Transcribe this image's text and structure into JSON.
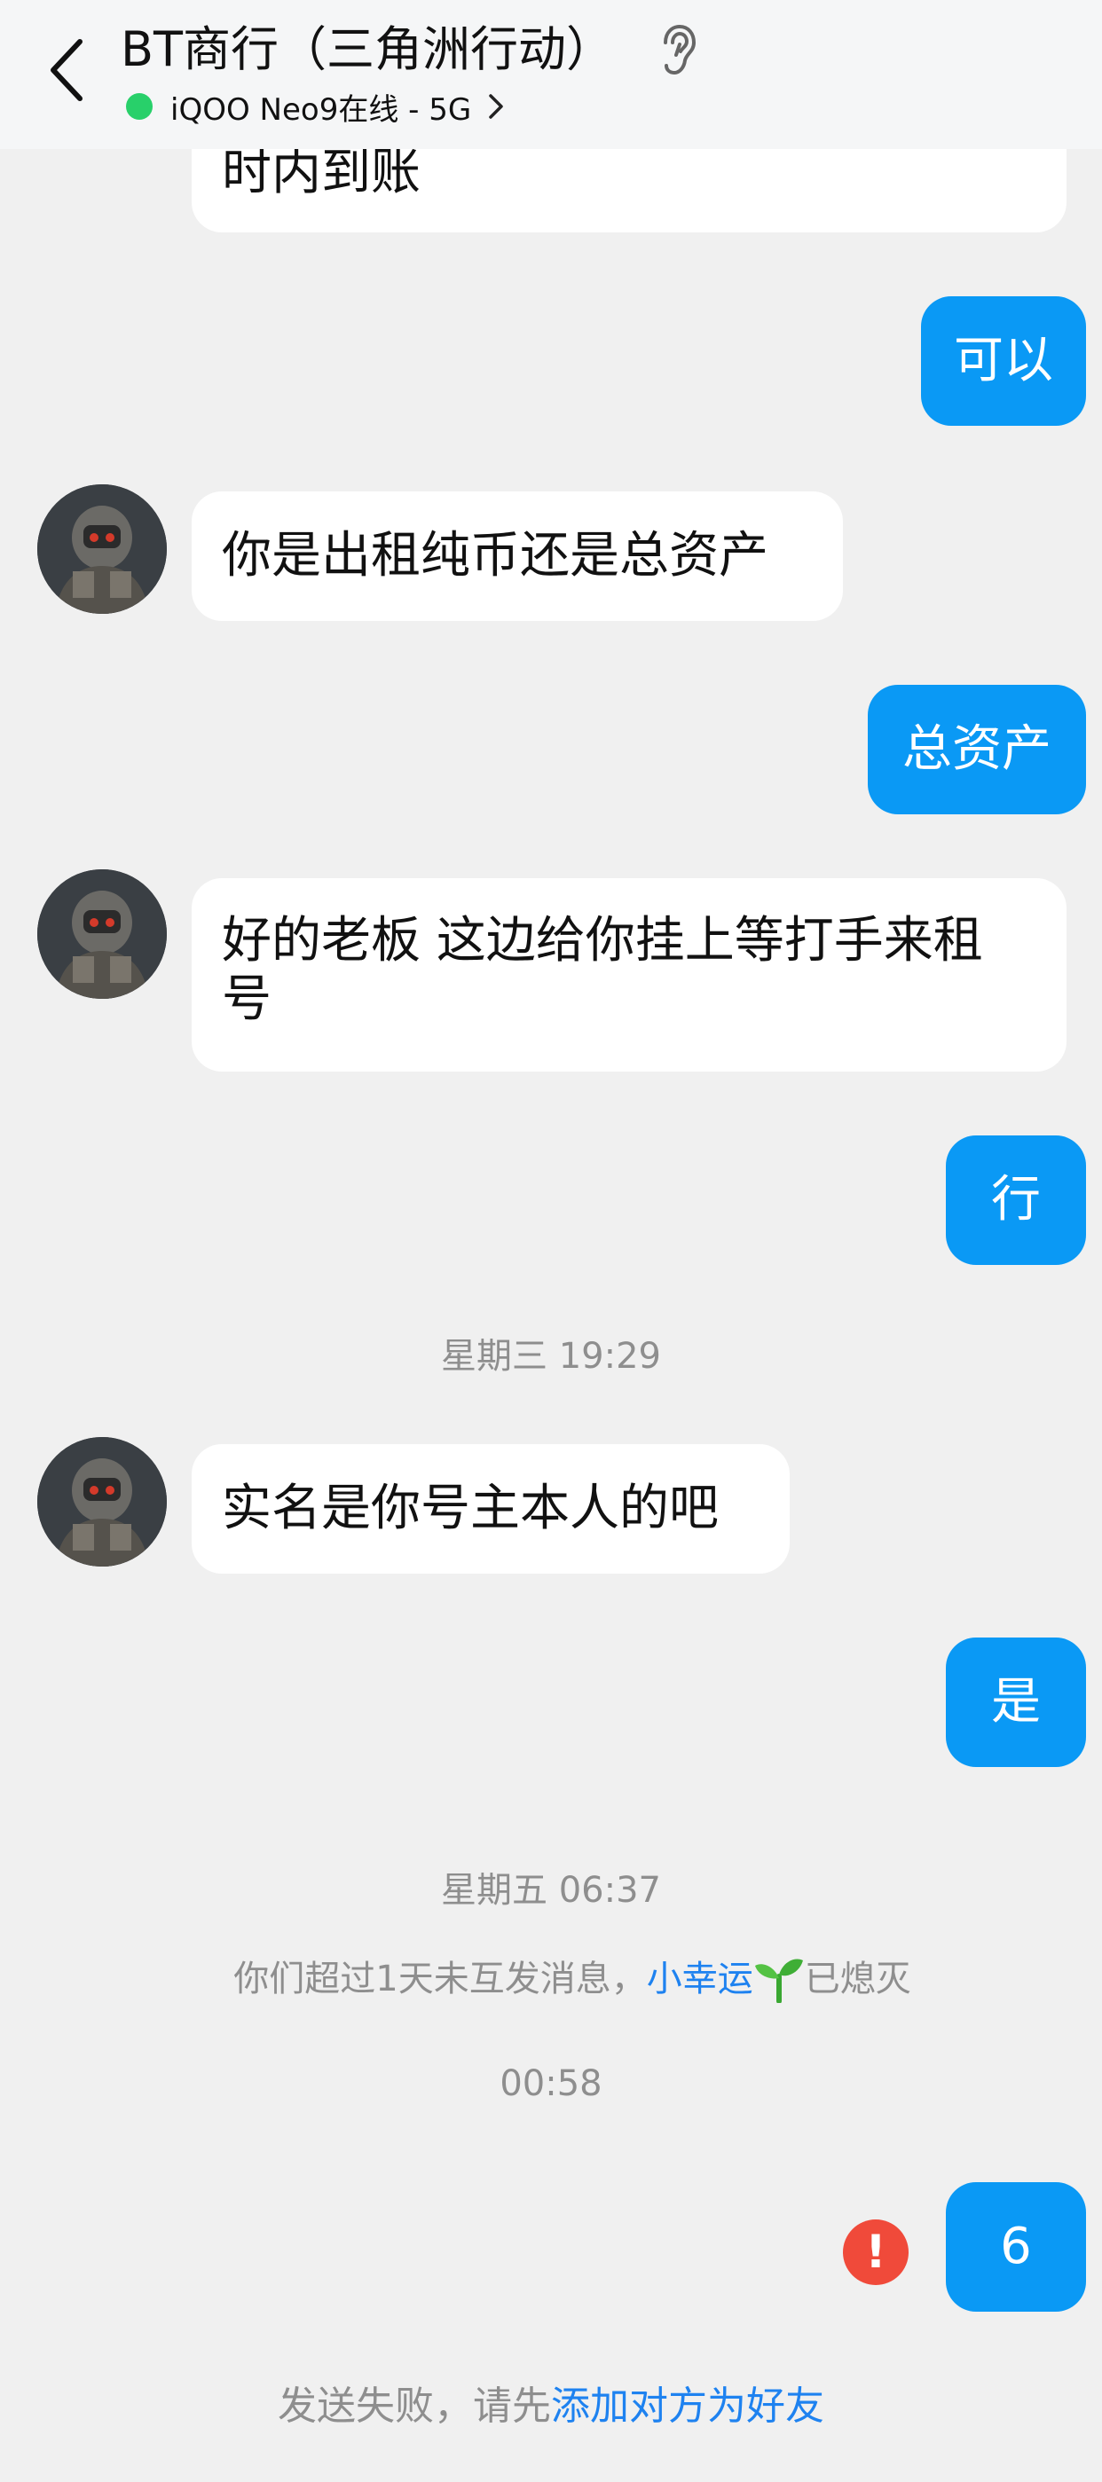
{
  "header": {
    "title": "BT商行（三角洲行动）",
    "status_text": "iQOO Neo9在线 - 5G",
    "status_color": "#28d06a"
  },
  "messages": [
    {
      "direction": "in",
      "text": "时内到账"
    },
    {
      "direction": "out",
      "text": "可以"
    },
    {
      "direction": "in",
      "text": "你是出租纯币还是总资产"
    },
    {
      "direction": "out",
      "text": "总资产"
    },
    {
      "direction": "in",
      "text": "好的老板 这边给你挂上等打手来租号"
    },
    {
      "direction": "out",
      "text": "行"
    },
    {
      "direction": "in",
      "text": "实名是你号主本人的吧"
    },
    {
      "direction": "out",
      "text": "是"
    },
    {
      "direction": "out",
      "text": "6"
    }
  ],
  "timestamps": {
    "t1": "星期三 19:29",
    "t2": "星期五 06:37",
    "t3": "00:58"
  },
  "system": {
    "streak_prefix": "你们超过1天未互发消息，",
    "streak_link": "小幸运",
    "streak_suffix": "已熄灭",
    "fail_prefix": "发送失败，请先",
    "fail_link": "添加对方为好友"
  },
  "colors": {
    "outgoing_bubble": "#0a99f5",
    "incoming_bubble": "#ffffff",
    "background": "#f0f0f0",
    "link": "#1e82f0",
    "error": "#f04a3a"
  },
  "icons": {
    "back": "chevron-left-icon",
    "ear": "ear-icon",
    "status_chevron": "chevron-right-icon",
    "error": "exclamation-icon",
    "sprout": "sprout-icon"
  }
}
